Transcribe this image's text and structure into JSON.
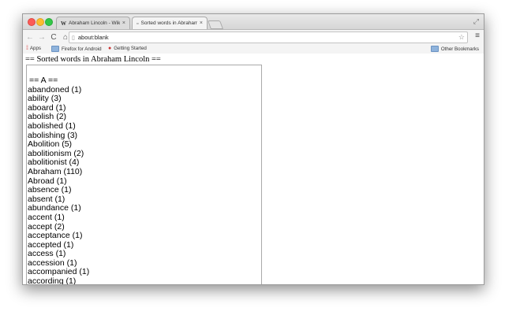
{
  "browser": {
    "tabs": [
      {
        "favicon": "W",
        "title": "Abraham Lincoln - Wikipe",
        "close": "×"
      },
      {
        "favicon": "▫",
        "title": "Sorted words in Abraham",
        "close": "×"
      }
    ],
    "address": "about:blank",
    "bookmarks": [
      {
        "label": "Apps",
        "icon": "apps-grid-icon"
      },
      {
        "label": "Firefox for Android",
        "icon": "folder-icon"
      },
      {
        "label": "Getting Started",
        "icon": "firefox-icon"
      }
    ],
    "other_bookmarks": "Other Bookmarks"
  },
  "page": {
    "heading": "== Sorted words in Abraham Lincoln ==",
    "section": "== A ==",
    "words": [
      "abandoned (1)",
      "ability (3)",
      "aboard (1)",
      "abolish (2)",
      "abolished (1)",
      "abolishing (3)",
      "Abolition (5)",
      "abolitionism (2)",
      "abolitionist (4)",
      "Abraham (110)",
      "Abroad (1)",
      "absence (1)",
      "absent (1)",
      "abundance (1)",
      "accent (1)",
      "accept (2)",
      "acceptance (1)",
      "accepted (1)",
      "access (1)",
      "accession (1)",
      "accompanied (1)",
      "according (1)"
    ]
  }
}
